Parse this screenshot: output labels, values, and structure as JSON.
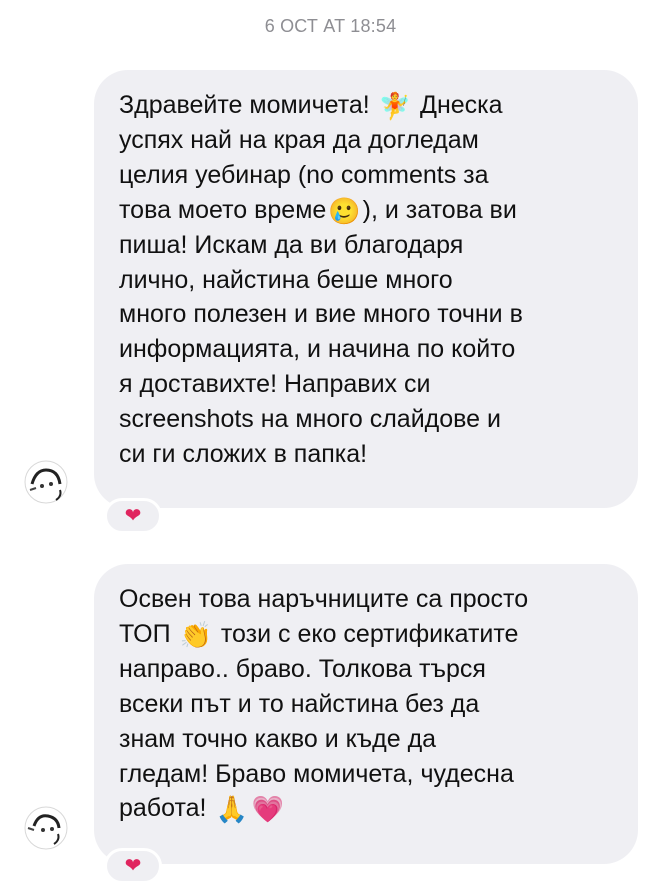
{
  "header": {
    "timestamp": "6 ОСТ AT 18:54"
  },
  "messages": [
    {
      "lines": [
        {
          "before": "Здравейте момичета! ",
          "emoji": "🧚",
          "after": " Днеска"
        },
        {
          "text": "успях най на края да догледам"
        },
        {
          "text": "целия уебинар (no comments за"
        },
        {
          "before": "това моето време",
          "emoji": "🥲",
          "after": "), и затова ви"
        },
        {
          "text": "пиша! Искам да ви благодаря"
        },
        {
          "text": "лично, найстина беше много"
        },
        {
          "text": "много полезен и вие много точни в"
        },
        {
          "text": "информацията, и начина по който"
        },
        {
          "text": "я доставихте! Направих си"
        },
        {
          "text": "screenshots на много слайдове и"
        },
        {
          "text": "си ги сложих в папка!"
        }
      ],
      "reaction": "❤",
      "avatar_icon": "user-avatar"
    },
    {
      "lines": [
        {
          "text": "Освен това наръчниците са просто"
        },
        {
          "before": "ТОП ",
          "emoji": "👏",
          "after": " този с еко сертификатите"
        },
        {
          "text": "направо.. браво. Толкова търся"
        },
        {
          "text": "всеки път и то найстина без да"
        },
        {
          "text": "знам точно какво и къде да"
        },
        {
          "text": "гледам! Браво момичета, чудесна"
        },
        {
          "before": "работа! ",
          "emoji": "🙏",
          "after": "",
          "emoji2": "💗"
        }
      ],
      "reaction": "❤",
      "avatar_icon": "user-avatar"
    }
  ],
  "colors": {
    "bubble_background": "#efeff3",
    "timestamp_text": "#8e8e93",
    "message_text": "#111111",
    "reaction_heart": "#e0245e"
  }
}
